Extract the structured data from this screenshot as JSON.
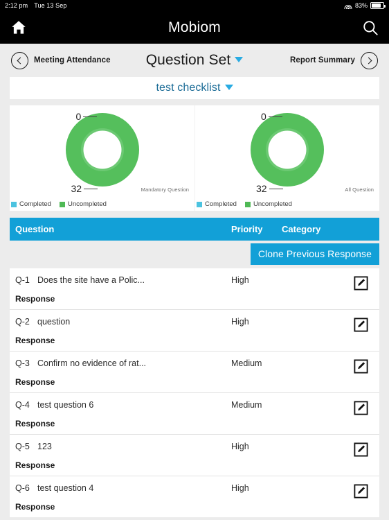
{
  "statusbar": {
    "time": "2:12 pm",
    "date": "Tue 13 Sep",
    "battery_percent": "83%",
    "wifi_icon": "wifi-icon",
    "battery_icon": "battery-icon"
  },
  "titlebar": {
    "app_title": "Mobiom",
    "home_icon": "home-icon",
    "search_icon": "search-icon"
  },
  "navrow": {
    "back_label": "Meeting Attendance",
    "back_icon": "chevron-left-circle-icon",
    "center_title": "Question Set",
    "center_caret": "caret-down-icon",
    "forward_label": "Report Summary",
    "forward_icon": "chevron-right-circle-icon"
  },
  "checklist": {
    "selected": "test checklist",
    "caret": "caret-down-icon"
  },
  "charts": [
    {
      "caption": "Mandatory Question",
      "top_value": "0",
      "bottom_value": "32",
      "legend": [
        {
          "label": "Completed",
          "color": "#4cc3e0"
        },
        {
          "label": "Uncompleted",
          "color": "#4fb955"
        }
      ]
    },
    {
      "caption": "All Question",
      "top_value": "0",
      "bottom_value": "32",
      "legend": [
        {
          "label": "Completed",
          "color": "#4cc3e0"
        },
        {
          "label": "Uncompleted",
          "color": "#4fb955"
        }
      ]
    }
  ],
  "chart_data": [
    {
      "type": "pie",
      "title": "Mandatory Question",
      "categories": [
        "Completed",
        "Uncompleted"
      ],
      "values": [
        0,
        32
      ],
      "colors": [
        "#4cc3e0",
        "#55bf5c"
      ],
      "labels": [
        "0",
        "32"
      ],
      "legend_position": "bottom-left",
      "donut": true
    },
    {
      "type": "pie",
      "title": "All Question",
      "categories": [
        "Completed",
        "Uncompleted"
      ],
      "values": [
        0,
        32
      ],
      "colors": [
        "#4cc3e0",
        "#55bf5c"
      ],
      "labels": [
        "0",
        "32"
      ],
      "legend_position": "bottom-left",
      "donut": true
    }
  ],
  "table": {
    "headers": {
      "question": "Question",
      "priority": "Priority",
      "category": "Category"
    },
    "clone_button": "Clone Previous Response",
    "response_label": "Response",
    "rows": [
      {
        "id": "Q-1",
        "text": "Does the site have a Polic...",
        "priority": "High",
        "category": "",
        "response": "Response",
        "edit_icon": "edit-icon"
      },
      {
        "id": "Q-2",
        "text": "question",
        "priority": "High",
        "category": "",
        "response": "Response",
        "edit_icon": "edit-icon"
      },
      {
        "id": "Q-3",
        "text": "Confirm no evidence of rat...",
        "priority": "Medium",
        "category": "",
        "response": "Response",
        "edit_icon": "edit-icon"
      },
      {
        "id": "Q-4",
        "text": "test question 6",
        "priority": "Medium",
        "category": "",
        "response": "Response",
        "edit_icon": "edit-icon"
      },
      {
        "id": "Q-5",
        "text": "123",
        "priority": "High",
        "category": "",
        "response": "Response",
        "edit_icon": "edit-icon"
      },
      {
        "id": "Q-6",
        "text": "test question 4",
        "priority": "High",
        "category": "",
        "response": "Response",
        "edit_icon": "edit-icon"
      }
    ]
  },
  "theme": {
    "accent_blue": "#12a0d7",
    "link_blue": "#1a6b96",
    "caret_blue": "#29abe2",
    "green": "#55bf5c",
    "page_bg": "#ececec"
  }
}
